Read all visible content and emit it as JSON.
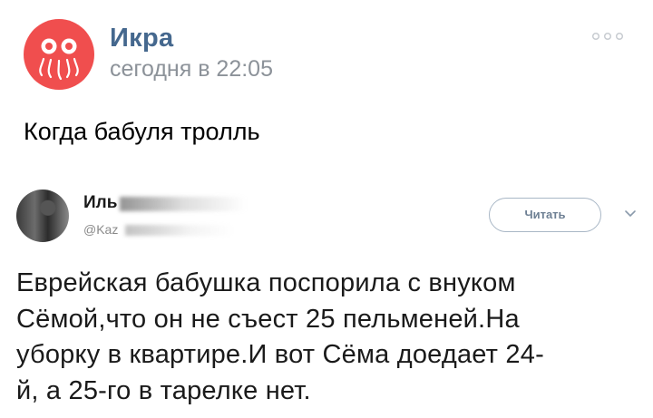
{
  "post": {
    "group_name": "Икра",
    "time": "сегодня в 22:05",
    "text": "Когда бабуля тролль"
  },
  "icons": {
    "avatar": "octopus-logo-icon",
    "more": "more-dots-icon",
    "dropdown": "chevron-down-icon"
  },
  "colors": {
    "avatar_bg": "#f04e4e",
    "group_name": "#45688e",
    "time": "#8c9299"
  },
  "tweet": {
    "name": "Иль",
    "handle": "@Kaz",
    "follow_label": "Читать",
    "lines": [
      "Еврейская бабушка поспорила с внуком",
      "Сёмой,что он не съест 25 пельменей.На",
      "уборку в квартире.И вот Сёма доедает 24-",
      "й, а 25-го в тарелке нет."
    ]
  }
}
